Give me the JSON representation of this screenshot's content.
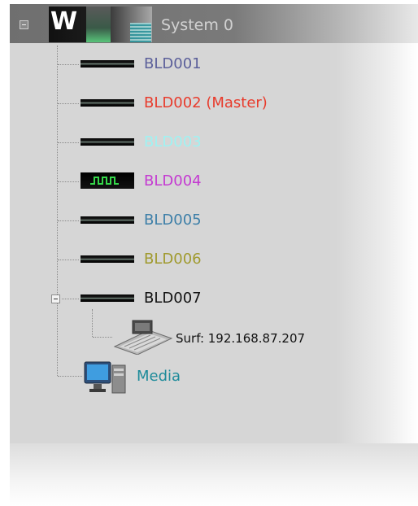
{
  "root": {
    "title": "System 0",
    "logo": "W",
    "icon": "system-logo-icon",
    "expanded": true
  },
  "nodes": [
    {
      "label": "BLD001",
      "color": "#5b5f9a",
      "icon": "bld-device-icon"
    },
    {
      "label": "BLD002 (Master)",
      "color": "#e83b2c",
      "icon": "bld-device-icon"
    },
    {
      "label": "BLD003",
      "color": "#9ff2f2",
      "icon": "bld-device-icon"
    },
    {
      "label": "BLD004",
      "color": "#c43ad1",
      "icon": "bld-signal-icon"
    },
    {
      "label": "BLD005",
      "color": "#3d7fa8",
      "icon": "bld-device-icon"
    },
    {
      "label": "BLD006",
      "color": "#a09a2e",
      "icon": "bld-device-icon"
    },
    {
      "label": "BLD007",
      "color": "#111111",
      "icon": "bld-device-icon",
      "expanded": true
    }
  ],
  "surf": {
    "label": "Surf: 192.168.87.207",
    "color": "#111111",
    "icon": "control-surface-icon"
  },
  "media": {
    "label": "Media",
    "color": "#1e8b9a",
    "icon": "computer-icon"
  }
}
